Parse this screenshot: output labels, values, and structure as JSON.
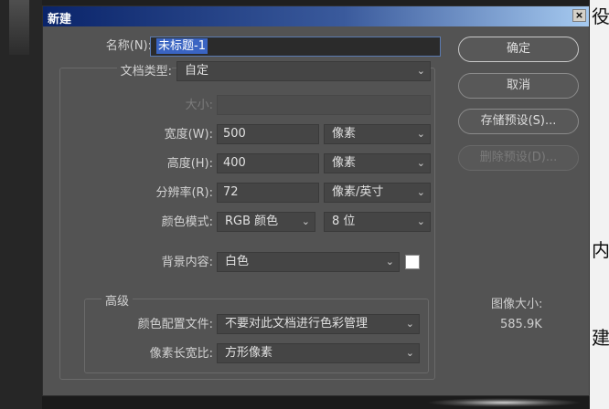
{
  "dialog": {
    "title": "新建",
    "close_glyph": "×"
  },
  "form": {
    "name_label": "名称(N):",
    "name_value": "未标题-1",
    "doc_type_label": "文档类型:",
    "doc_type_value": "自定",
    "size_label": "大小:",
    "size_value": "",
    "width_label": "宽度(W):",
    "width_value": "500",
    "width_unit": "像素",
    "height_label": "高度(H):",
    "height_value": "400",
    "height_unit": "像素",
    "resolution_label": "分辨率(R):",
    "resolution_value": "72",
    "resolution_unit": "像素/英寸",
    "color_mode_label": "颜色模式:",
    "color_mode_value": "RGB 颜色",
    "bit_depth_value": "8 位",
    "background_label": "背景内容:",
    "background_value": "白色",
    "background_swatch_color": "#ffffff"
  },
  "advanced": {
    "title": "高级",
    "color_profile_label": "颜色配置文件:",
    "color_profile_value": "不要对此文档进行色彩管理",
    "pixel_aspect_label": "像素长宽比:",
    "pixel_aspect_value": "方形像素"
  },
  "buttons": {
    "ok": "确定",
    "cancel": "取消",
    "save_preset": "存储预设(S)...",
    "delete_preset": "删除预设(D)..."
  },
  "image_size": {
    "label": "图像大小:",
    "value": "585.9K"
  },
  "background_text": {
    "top": "役",
    "middle": "内",
    "bottom": "建"
  },
  "colors": {
    "dialog_bg": "#535353",
    "titlebar_start": "#0a246a",
    "titlebar_end": "#a6caf0",
    "selection": "#3a64c2"
  }
}
